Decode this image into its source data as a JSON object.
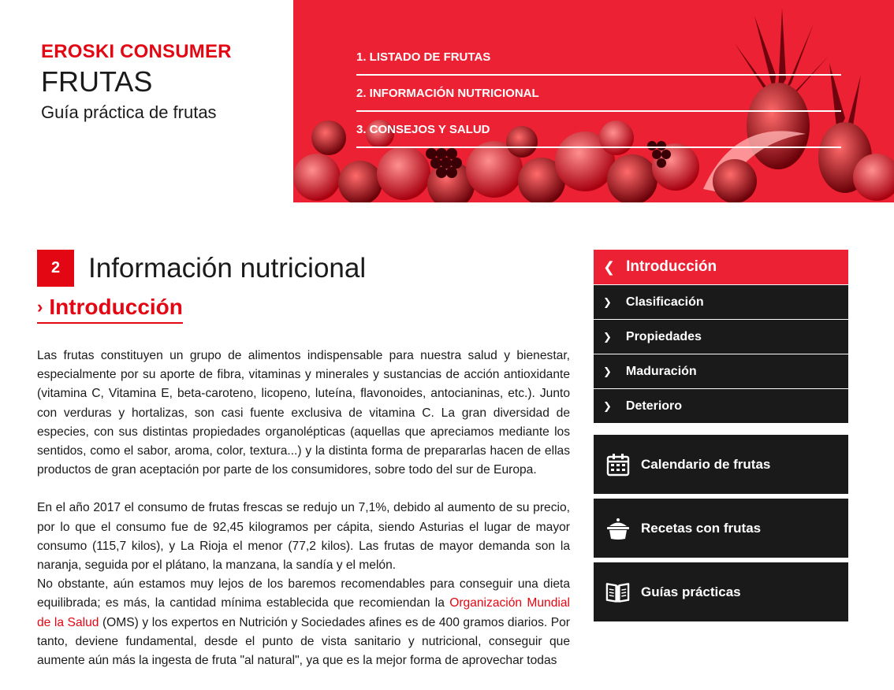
{
  "brand": {
    "name": "EROSKI CONSUMER",
    "title": "FRUTAS",
    "subtitle": "Guía práctica de frutas"
  },
  "banner_nav": [
    {
      "label": "1. LISTADO DE FRUTAS"
    },
    {
      "label": "2. INFORMACIÓN NUTRICIONAL"
    },
    {
      "label": "3. CONSEJOS Y SALUD"
    }
  ],
  "section": {
    "number": "2",
    "title": "Información nutricional",
    "subsection": "Introducción"
  },
  "article": {
    "p1": "Las frutas constituyen un grupo de alimentos indispensable para nuestra salud y bienestar, especialmente por su aporte de fibra, vitaminas y minerales y sustancias de acción antioxidante (vitamina C, Vitamina E, beta-caroteno, licopeno, luteína, flavonoides, antocianinas, etc.). Junto con verduras y hortalizas, son casi fuente exclusiva de vitamina C. La gran diversidad de especies, con sus distintas propiedades organolépticas (aquellas que apreciamos mediante los sentidos, como el sabor, aroma, color, textura...) y la distinta forma de prepararlas hacen de ellas productos de gran aceptación por parte de los consumidores, sobre todo del sur de Europa.",
    "p2": "En el año 2017 el consumo de frutas frescas se redujo un 7,1%, debido al aumento de su precio, por lo que el consumo fue de 92,45 kilogramos per cápita, siendo Asturias el lugar de mayor consumo (115,7 kilos), y La Rioja el menor (77,2 kilos). Las frutas de mayor demanda son la naranja, seguida por el plátano, la manzana, la sandía y el melón.",
    "p3_before": "No obstante, aún estamos muy lejos de los baremos recomendables para conseguir una dieta equilibrada; es más, la cantidad mínima establecida que recomiendan la ",
    "p3_link": "Organización Mundial de la Salud",
    "p3_after": " (OMS) y los  expertos en Nutrición y Sociedades afines es de 400 gramos diarios. Por tanto, deviene fundamental, desde el punto de vista sanitario y nutricional, conseguir que aumente aún más la ingesta de fruta \"al natural\", ya que es la mejor forma de aprovechar todas"
  },
  "sidebar": {
    "active": "Introducción",
    "items": [
      {
        "label": "Clasificación"
      },
      {
        "label": "Propiedades"
      },
      {
        "label": "Maduración"
      },
      {
        "label": "Deterioro"
      }
    ],
    "tools": [
      {
        "label": "Calendario de frutas",
        "icon": "calendar-icon"
      },
      {
        "label": "Recetas con frutas",
        "icon": "cooking-pot-icon"
      },
      {
        "label": "Guías prácticas",
        "icon": "open-book-icon"
      }
    ]
  },
  "colors": {
    "brand_red": "#e30613",
    "banner_red": "#ec2133",
    "sidebar_dark": "#1a1a1a"
  }
}
